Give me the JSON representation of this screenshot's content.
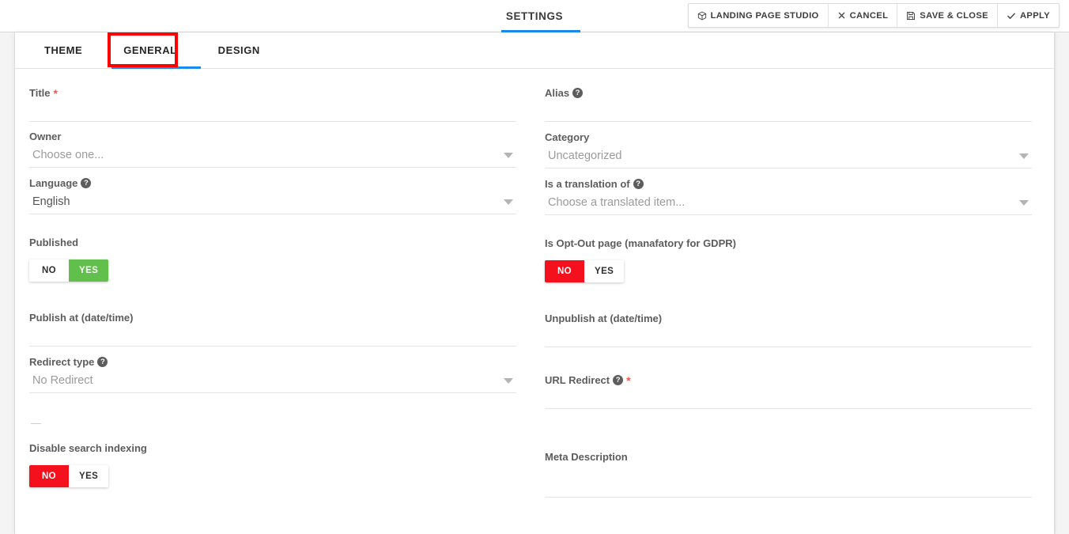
{
  "header": {
    "title": "SETTINGS",
    "accent_color": "#1a8cf0",
    "buttons": [
      {
        "label": "LANDING PAGE STUDIO",
        "icon": "cube-icon"
      },
      {
        "label": "CANCEL",
        "icon": "close-icon"
      },
      {
        "label": "SAVE & CLOSE",
        "icon": "save-icon"
      },
      {
        "label": "APPLY",
        "icon": "check-icon"
      }
    ]
  },
  "tabs": {
    "items": [
      {
        "label": "THEME",
        "active": false
      },
      {
        "label": "GENERAL",
        "active": true
      },
      {
        "label": "DESIGN",
        "active": false
      }
    ],
    "highlight_color": "#fe0000"
  },
  "form": {
    "left": {
      "title": {
        "label": "Title",
        "required": "*",
        "value": ""
      },
      "owner": {
        "label": "Owner",
        "value": "Choose one..."
      },
      "language": {
        "label": "Language",
        "help": "?",
        "value": "English"
      },
      "published": {
        "label": "Published",
        "no": "NO",
        "yes": "YES",
        "selected": "YES",
        "active_color": "#61bf4b"
      },
      "publish_at": {
        "label": "Publish at (date/time)",
        "value": ""
      },
      "redirect_type": {
        "label": "Redirect type",
        "help": "?",
        "value": "No Redirect"
      },
      "separator": "—",
      "disable_search_indexing": {
        "label": "Disable search indexing",
        "no": "NO",
        "yes": "YES",
        "selected": "NO",
        "active_color": "#f5101e"
      }
    },
    "right": {
      "alias": {
        "label": "Alias",
        "help": "?",
        "value": ""
      },
      "category": {
        "label": "Category",
        "value": "Uncategorized"
      },
      "is_translation_of": {
        "label": "Is a translation of",
        "help": "?",
        "value": "Choose a translated item..."
      },
      "opt_out": {
        "label": "Is Opt-Out page (manafatory for GDPR)",
        "no": "NO",
        "yes": "YES",
        "selected": "NO",
        "active_color": "#f5101e"
      },
      "unpublish_at": {
        "label": "Unpublish at (date/time)",
        "value": ""
      },
      "url_redirect": {
        "label": "URL Redirect",
        "help": "?",
        "required": "*",
        "value": ""
      },
      "meta_description": {
        "label": "Meta Description",
        "value": ""
      }
    }
  }
}
